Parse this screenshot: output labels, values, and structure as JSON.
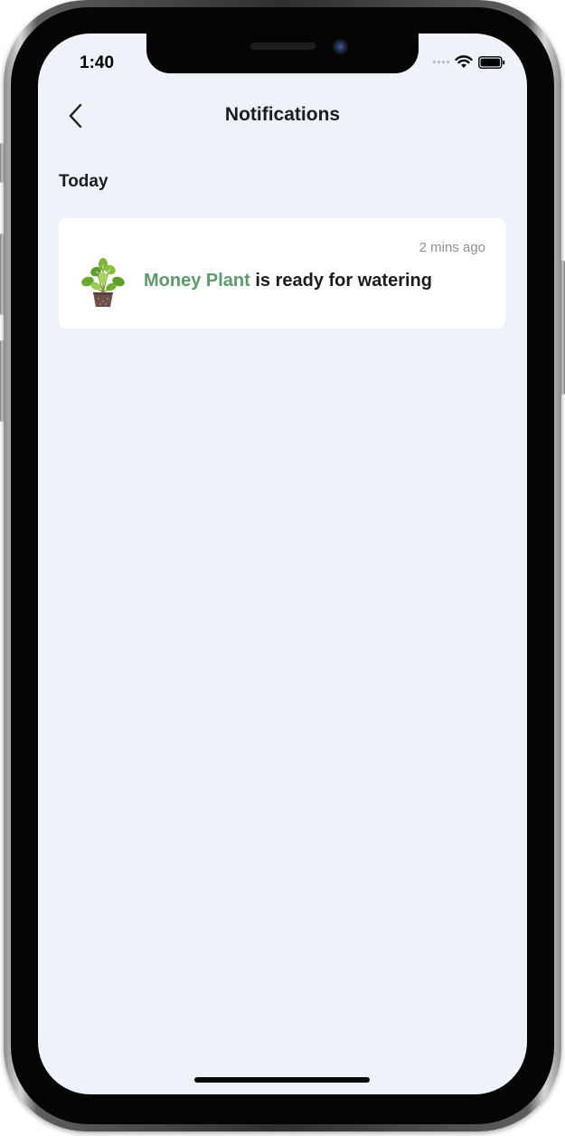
{
  "status_bar": {
    "time": "1:40",
    "signal_icon": "signal-bars-icon",
    "wifi_icon": "wifi-icon",
    "battery_icon": "battery-icon"
  },
  "nav": {
    "back_icon": "chevron-left-icon",
    "title": "Notifications"
  },
  "section": {
    "title": "Today"
  },
  "notifications": [
    {
      "time": "2 mins ago",
      "plant_name": "Money Plant",
      "message": " is ready for watering",
      "thumbnail_icon": "money-plant-icon"
    }
  ],
  "colors": {
    "background": "#edf3f8",
    "card": "#ffffff",
    "accent_green": "#5c9a6a",
    "text_primary": "#1c1c1e",
    "text_secondary": "#8d8f94"
  }
}
